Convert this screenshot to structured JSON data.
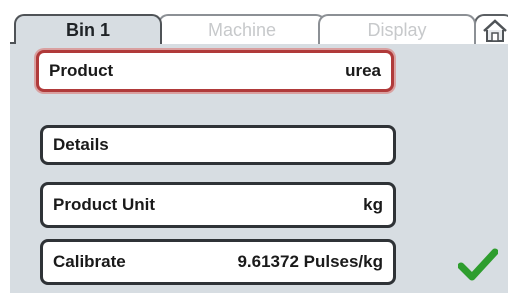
{
  "tabs": [
    {
      "label": "Bin 1",
      "active": true
    },
    {
      "label": "Machine",
      "active": false
    },
    {
      "label": "Display",
      "active": false
    }
  ],
  "home_tab": {
    "icon": "home-icon"
  },
  "rows": [
    {
      "label": "Product",
      "value": "urea",
      "selected": true
    },
    {
      "label": "Details",
      "value": "",
      "selected": false
    },
    {
      "label": "Product Unit",
      "value": "kg",
      "selected": false
    },
    {
      "label": "Calibrate",
      "value": "9.61372 Pulses/kg",
      "selected": false
    }
  ],
  "confirm": {
    "icon": "checkmark-icon"
  },
  "colors": {
    "panel": "#d7dde2",
    "selected_border": "#b03a3a",
    "row_border": "#2f3337",
    "check_green": "#2e9d2e"
  }
}
